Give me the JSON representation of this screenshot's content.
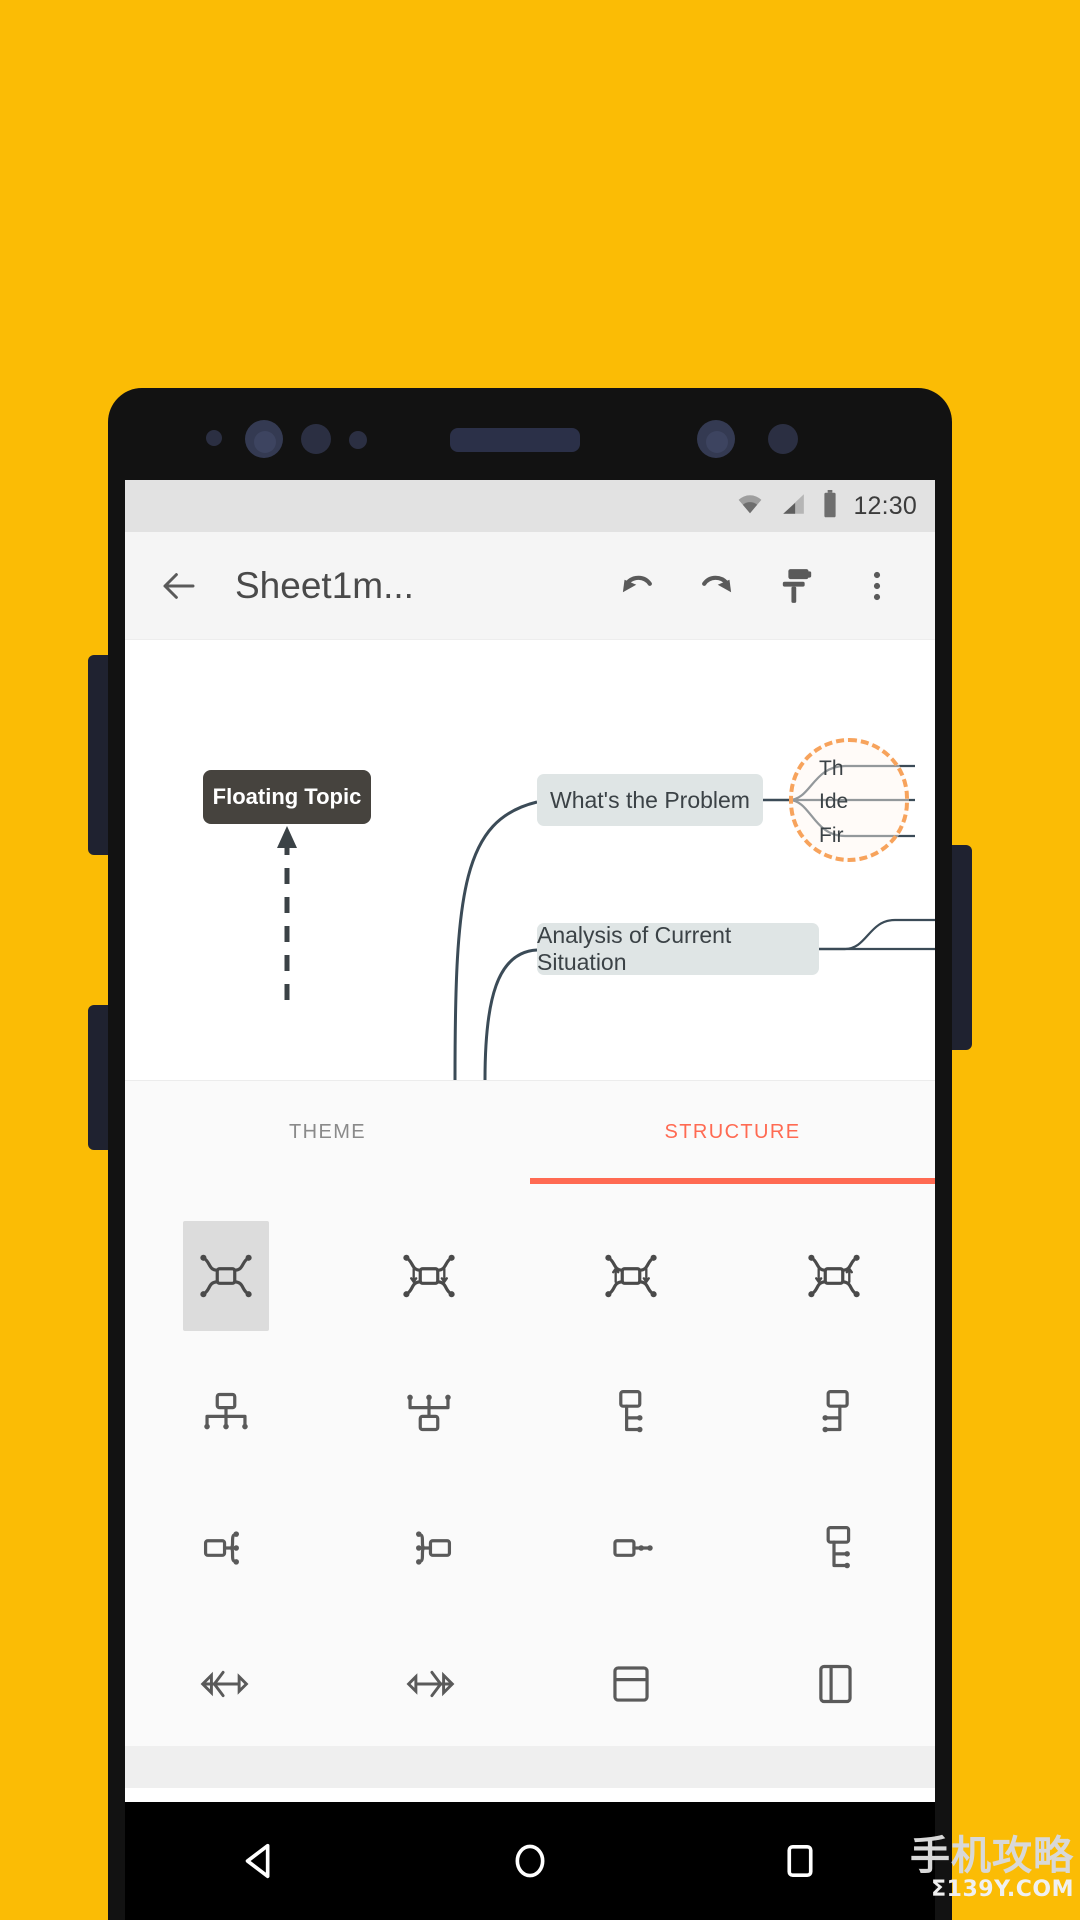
{
  "background_color": "#FBBC05",
  "status_bar": {
    "wifi_icon": "wifi-icon",
    "signal_icon": "cellular-signal-icon",
    "battery_icon": "battery-icon",
    "clock": "12:30"
  },
  "app_toolbar": {
    "back_icon": "back-arrow-icon",
    "title": "Sheet1m...",
    "undo_icon": "undo-icon",
    "redo_icon": "redo-icon",
    "format_icon": "format-paint-icon",
    "overflow_icon": "more-vertical-icon"
  },
  "mindmap": {
    "floating_topic": "Floating Topic",
    "branch_1": "What's the Problem",
    "branch_2": "Analysis of Current Situation",
    "sub_nodes": [
      "Th",
      "Ide",
      "Fir"
    ],
    "selection_color": "#F7A35C"
  },
  "panel": {
    "accent_color": "#FF6A52",
    "tabs": [
      {
        "label": "THEME",
        "active": false
      },
      {
        "label": "STRUCTURE",
        "active": true
      }
    ],
    "structures": [
      {
        "name": "balanced-map",
        "selected": true
      },
      {
        "name": "balanced-map-right",
        "selected": false
      },
      {
        "name": "balanced-map-clockwise",
        "selected": false
      },
      {
        "name": "balanced-map-alt",
        "selected": false
      },
      {
        "name": "org-chart-down",
        "selected": false
      },
      {
        "name": "org-chart-up",
        "selected": false
      },
      {
        "name": "tree-chart-right",
        "selected": false
      },
      {
        "name": "tree-chart-left",
        "selected": false
      },
      {
        "name": "logic-chart-right",
        "selected": false
      },
      {
        "name": "logic-chart-left",
        "selected": false
      },
      {
        "name": "timeline-horizontal",
        "selected": false
      },
      {
        "name": "tree-table",
        "selected": false
      },
      {
        "name": "fishbone-left",
        "selected": false
      },
      {
        "name": "fishbone-right",
        "selected": false
      },
      {
        "name": "matrix-horizontal",
        "selected": false
      },
      {
        "name": "matrix-vertical",
        "selected": false
      }
    ]
  },
  "navbar": {
    "back_icon": "nav-back-triangle-icon",
    "home_icon": "nav-home-circle-icon",
    "recents_icon": "nav-recents-square-icon"
  },
  "watermark": {
    "main": "手机攻略",
    "sub": "Σ139Y.COM"
  }
}
